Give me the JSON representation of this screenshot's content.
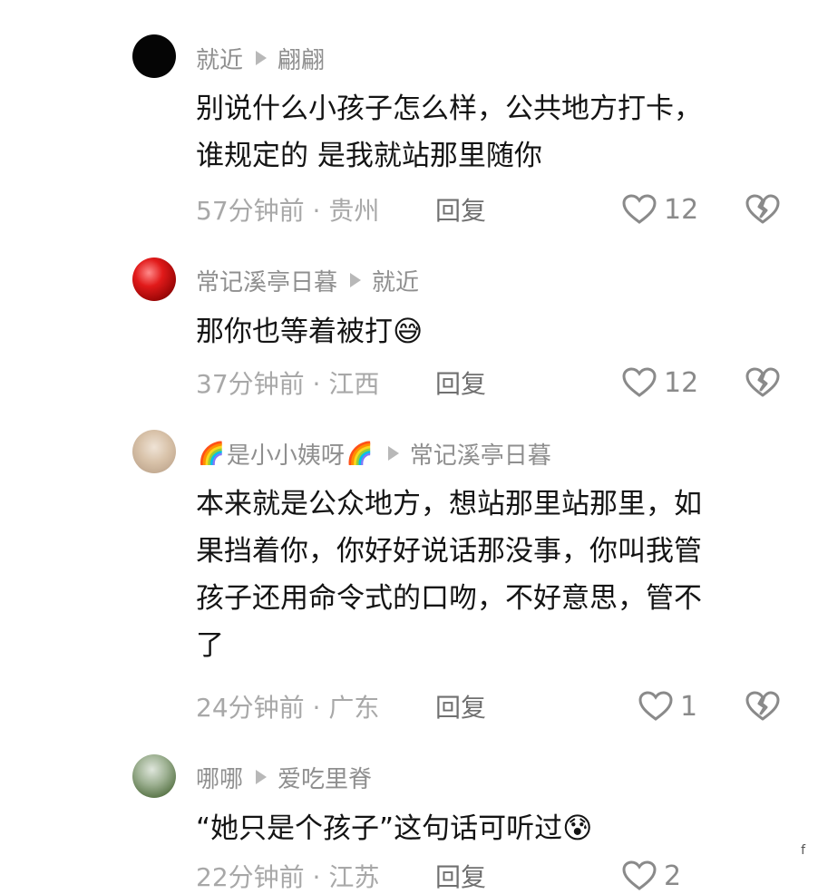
{
  "comments": [
    {
      "user": "就近",
      "reply_to": "翩翩",
      "text": "别说什么小孩子怎么样，公共地方打卡，\n谁规定的 是我就站那里随你",
      "time_location": "57分钟前 · 贵州",
      "reply_label": "回复",
      "likes": "12"
    },
    {
      "user": "常记溪亭日暮",
      "reply_to": "就近",
      "text": "那你也等着被打",
      "emoji": "😅",
      "time_location": "37分钟前 · 江西",
      "reply_label": "回复",
      "likes": "12"
    },
    {
      "user": "是小小姨呀",
      "rainbow": "🌈",
      "reply_to": "常记溪亭日暮",
      "text": "本来就是公众地方，想站那里站那里，如\n果挡着你，你好好说话那没事，你叫我管\n孩子还用命令式的口吻，不好意思，管不\n了",
      "time_location": "24分钟前 · 广东",
      "reply_label": "回复",
      "likes": "1"
    },
    {
      "user": "哪哪",
      "reply_to": "爱吃里脊",
      "text": "“她只是个孩子”这句话可听过",
      "emoji": "😰",
      "time_location": "22分钟前 · 江苏",
      "reply_label": "回复",
      "likes": "2"
    }
  ],
  "watermark": "f"
}
